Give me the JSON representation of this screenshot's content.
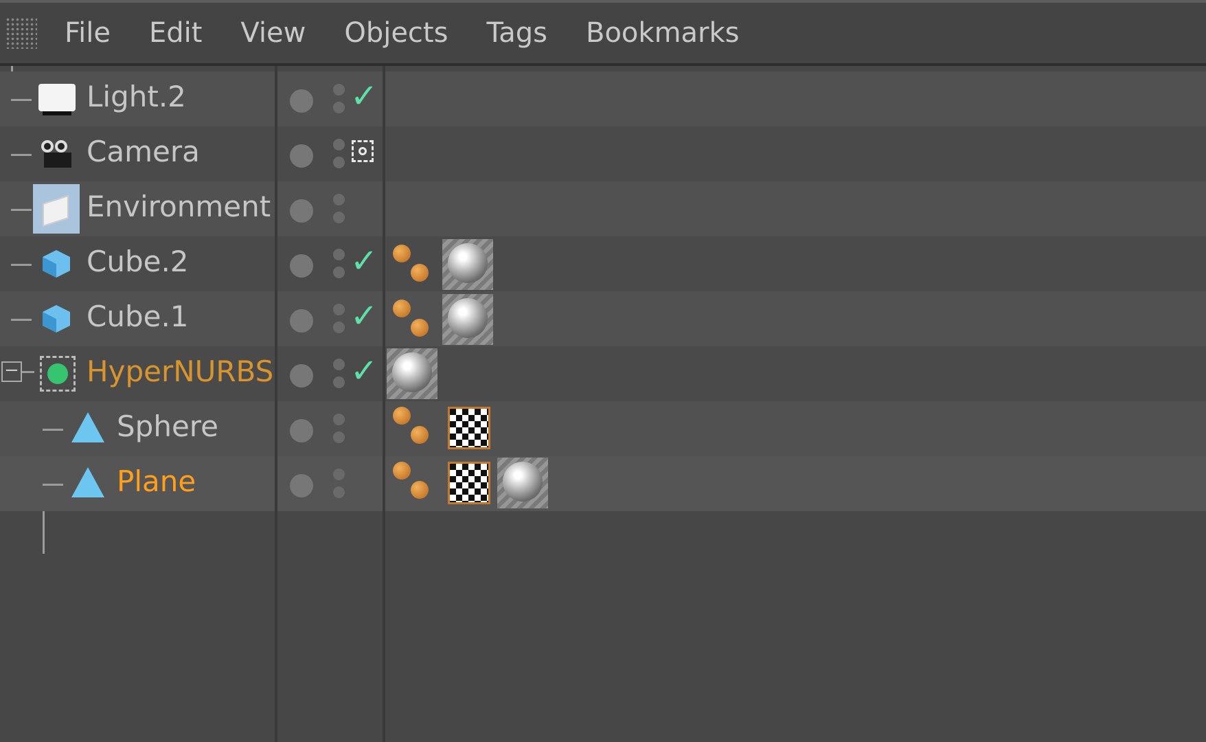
{
  "menu": [
    {
      "label": "File"
    },
    {
      "label": "Edit"
    },
    {
      "label": "View"
    },
    {
      "label": "Objects"
    },
    {
      "label": "Tags"
    },
    {
      "label": "Bookmarks"
    }
  ],
  "objects": [
    {
      "name": "Light.2",
      "icon": "light-icon",
      "enabled_state": "checked",
      "tags": []
    },
    {
      "name": "Camera",
      "icon": "camera-icon",
      "enabled_state": "target",
      "tags": []
    },
    {
      "name": "Environment",
      "icon": "environment-icon",
      "enabled_state": "none",
      "tags": []
    },
    {
      "name": "Cube.2",
      "icon": "cube-icon",
      "enabled_state": "checked",
      "tags": [
        "phong-tag",
        "material-tag"
      ]
    },
    {
      "name": "Cube.1",
      "icon": "cube-icon",
      "enabled_state": "checked",
      "tags": [
        "phong-tag",
        "material-tag"
      ]
    },
    {
      "name": "HyperNURBS",
      "icon": "hypernurbs-icon",
      "enabled_state": "checked",
      "tags": [
        "material-tag"
      ],
      "expanded": true
    },
    {
      "name": "Sphere",
      "icon": "primitive-icon",
      "enabled_state": "none",
      "tags": [
        "phong-tag",
        "uvw-tag"
      ]
    },
    {
      "name": "Plane",
      "icon": "primitive-icon",
      "enabled_state": "none",
      "tags": [
        "phong-tag",
        "uvw-tag",
        "material-tag"
      ],
      "active": true
    }
  ],
  "colors": {
    "active_object": "#ff9f1a",
    "parent_object": "#d8952e",
    "check": "#5fe0a8"
  }
}
